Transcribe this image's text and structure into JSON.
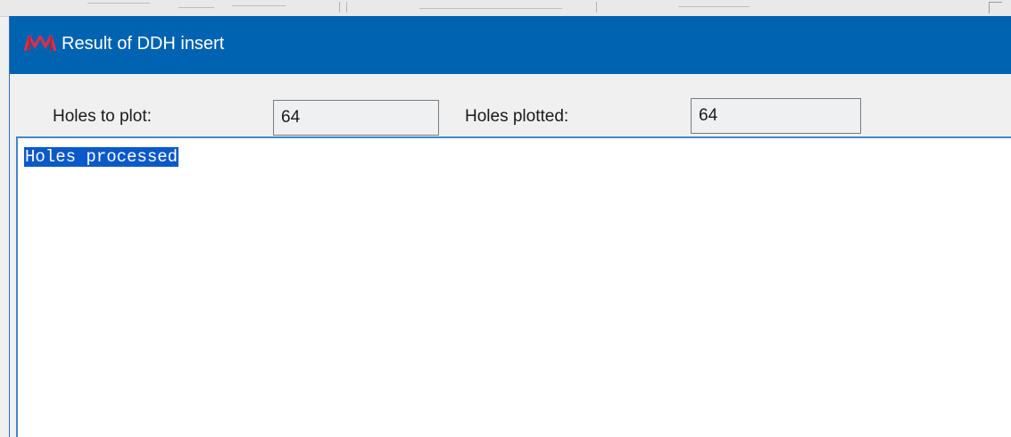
{
  "dialog": {
    "title": "Result of DDH insert",
    "logo_icon": "app-logo-icon",
    "title_bar_color": "#0063b1"
  },
  "fields": {
    "holes_to_plot": {
      "label": "Holes to plot:",
      "value": "64"
    },
    "holes_plotted": {
      "label": "Holes plotted:",
      "value": "64"
    }
  },
  "output": {
    "lines": [
      "Holes processed"
    ],
    "selection_color": "#0a59c9"
  }
}
